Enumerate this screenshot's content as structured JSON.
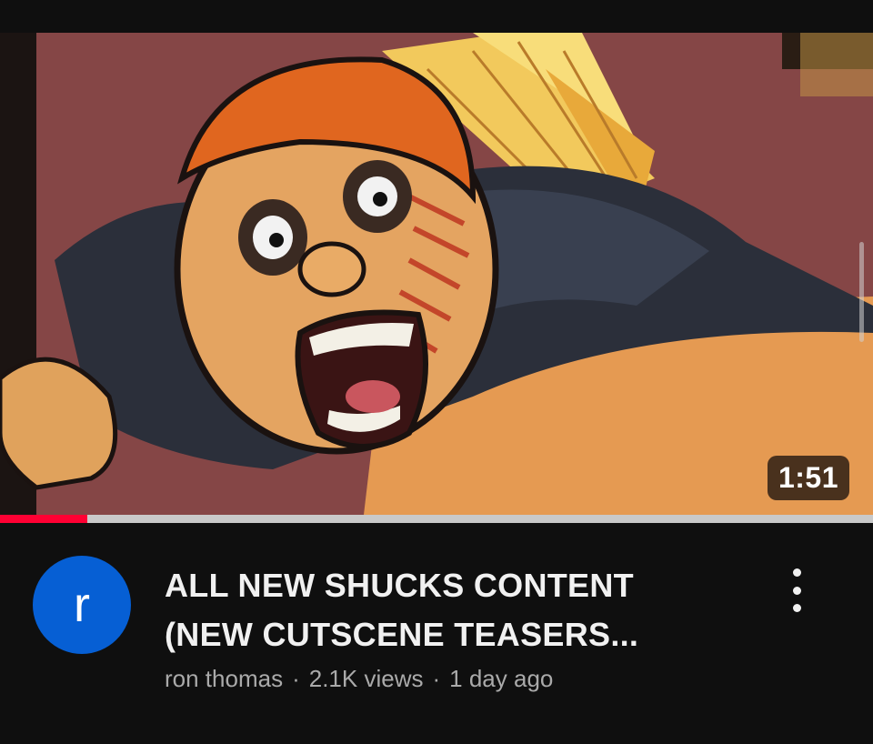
{
  "video": {
    "duration": "1:51",
    "watch_progress": 0.1,
    "thumbnail_icon": "cartoon-screaming-character-thumbnail"
  },
  "channel": {
    "avatar_letter": "r",
    "avatar_color": "#065fd4",
    "name": "ron thomas"
  },
  "title": {
    "line1": "ALL NEW SHUCKS CONTENT",
    "line2": "(NEW CUTSCENE TEASERS..."
  },
  "stats": {
    "views": "2.1K views",
    "age": "1 day ago",
    "separator": "·"
  },
  "menu": {
    "icon": "more-vertical-icon"
  },
  "colors": {
    "background": "#0f0f0f",
    "progress": "#ff0033",
    "title": "#f1f1f1",
    "meta": "#aaaaaa"
  }
}
